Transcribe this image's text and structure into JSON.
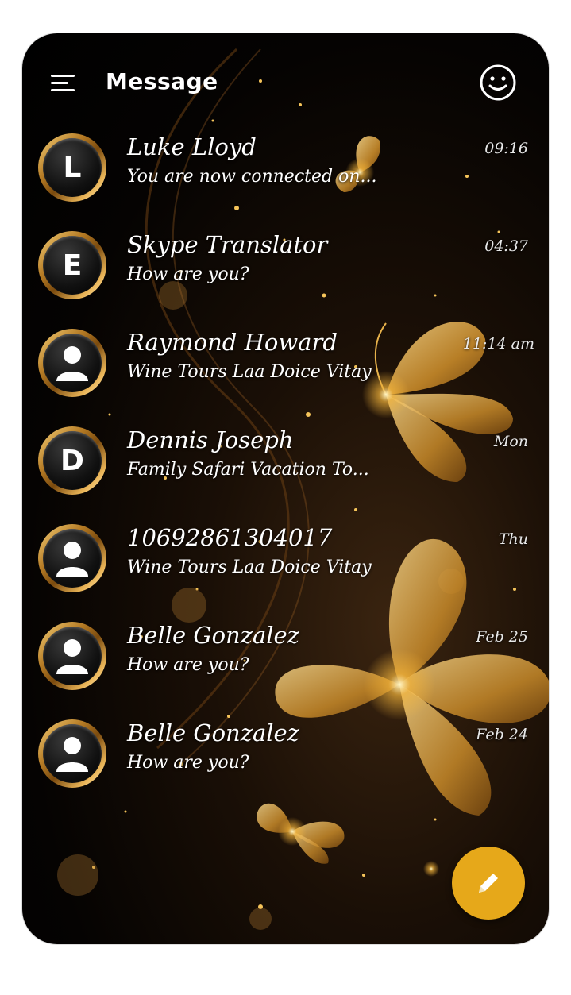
{
  "app": {
    "title": "Message"
  },
  "header": {
    "menu_icon": "hamburger-menu-icon",
    "emoji_icon": "smiley-face-icon"
  },
  "conversations": [
    {
      "avatar_letter": "L",
      "name": "Luke Lloyd",
      "preview": "You are now connected on...",
      "time": "09:16"
    },
    {
      "avatar_letter": "E",
      "name": "Skype Translator",
      "preview": "How are you?",
      "time": "04:37"
    },
    {
      "avatar_letter": "",
      "name": "Raymond Howard",
      "preview": "Wine Tours Laa Doice Vitay",
      "time": "11:14 am"
    },
    {
      "avatar_letter": "D",
      "name": "Dennis Joseph",
      "preview": "Family Safari Vacation To...",
      "time": "Mon"
    },
    {
      "avatar_letter": "",
      "name": "10692861304017",
      "preview": "Wine Tours Laa Doice Vitay",
      "time": "Thu"
    },
    {
      "avatar_letter": "",
      "name": "Belle Gonzalez",
      "preview": "How are you?",
      "time": "Feb 25"
    },
    {
      "avatar_letter": "",
      "name": "Belle Gonzalez",
      "preview": "How are you?",
      "time": "Feb 24"
    }
  ],
  "fab": {
    "icon": "pencil-compose-icon"
  },
  "colors": {
    "accent": "#e6a81a",
    "gold": "#d9a441",
    "background": "#000000"
  }
}
